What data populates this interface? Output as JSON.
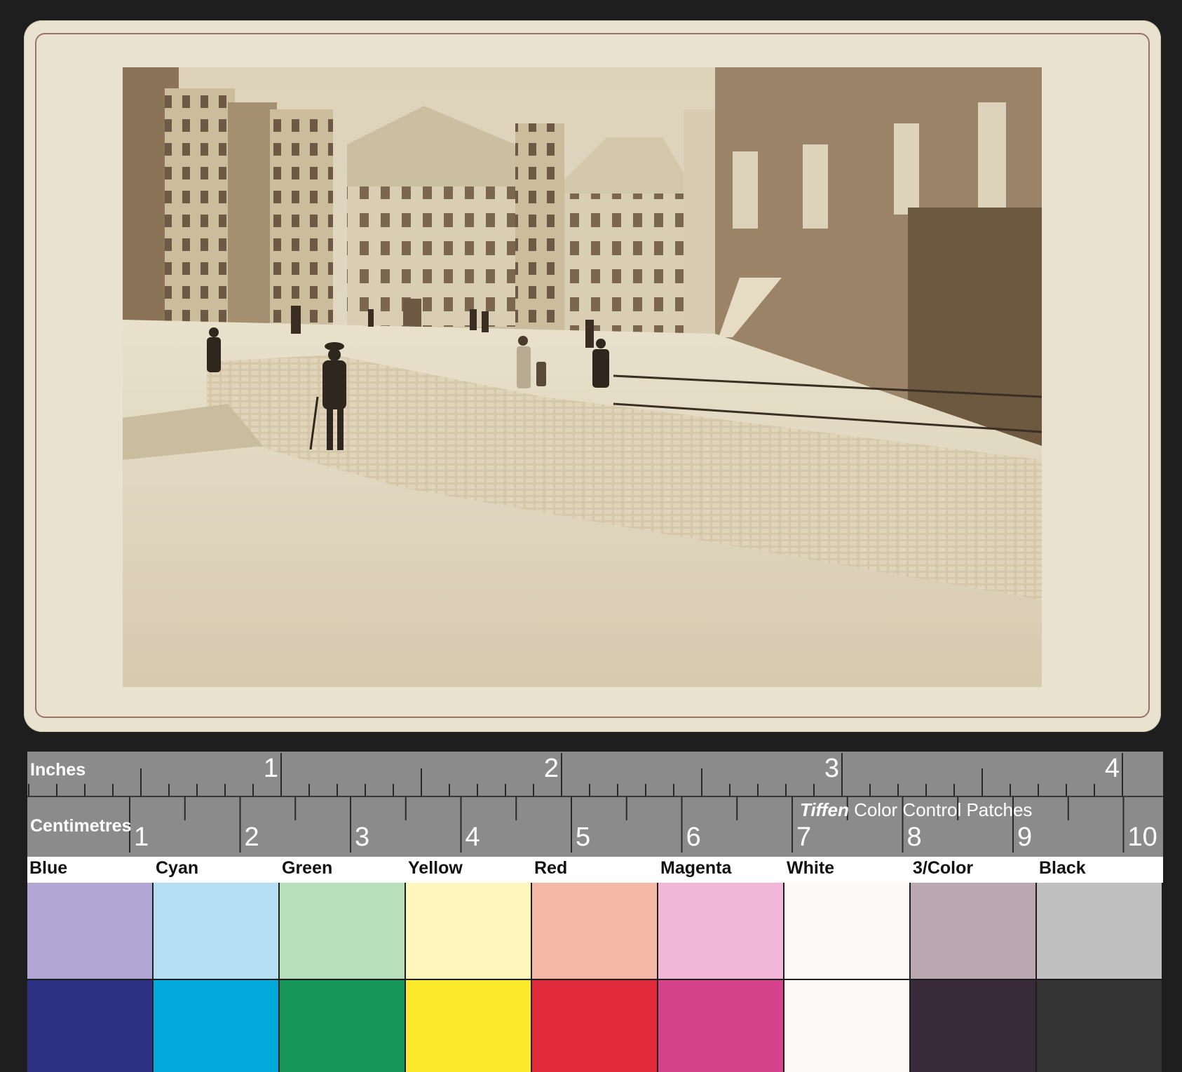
{
  "ruler": {
    "inches_label": "Inches",
    "centimetres_label": "Centimetres",
    "inch_numbers": [
      "1",
      "2",
      "3",
      "4"
    ],
    "cm_numbers": [
      "1",
      "2",
      "3",
      "4",
      "5",
      "6",
      "7",
      "8",
      "9",
      "10"
    ]
  },
  "patches_title": {
    "brand": "Tiffen",
    "text": "Color Control Patches"
  },
  "color_patches": [
    {
      "label": "Blue",
      "light": "#b2a6d5",
      "dark": "#2e3083"
    },
    {
      "label": "Cyan",
      "light": "#b4def1",
      "dark": "#00a8dc"
    },
    {
      "label": "Green",
      "light": "#b7dfb9",
      "dark": "#17965a"
    },
    {
      "label": "Yellow",
      "light": "#fdf7bd",
      "dark": "#fde92c"
    },
    {
      "label": "Red",
      "light": "#f3b8a5",
      "dark": "#e0293b"
    },
    {
      "label": "Magenta",
      "light": "#f2b6d8",
      "dark": "#d5448b"
    },
    {
      "label": "White",
      "light": "#fbfaf7",
      "dark": "#fbfaf7"
    },
    {
      "label": "3/Color",
      "light": "#b9a8b0",
      "dark": "#3a2b3a"
    },
    {
      "label": "Black",
      "light": "#c0c0c0",
      "dark": "#333333"
    }
  ]
}
